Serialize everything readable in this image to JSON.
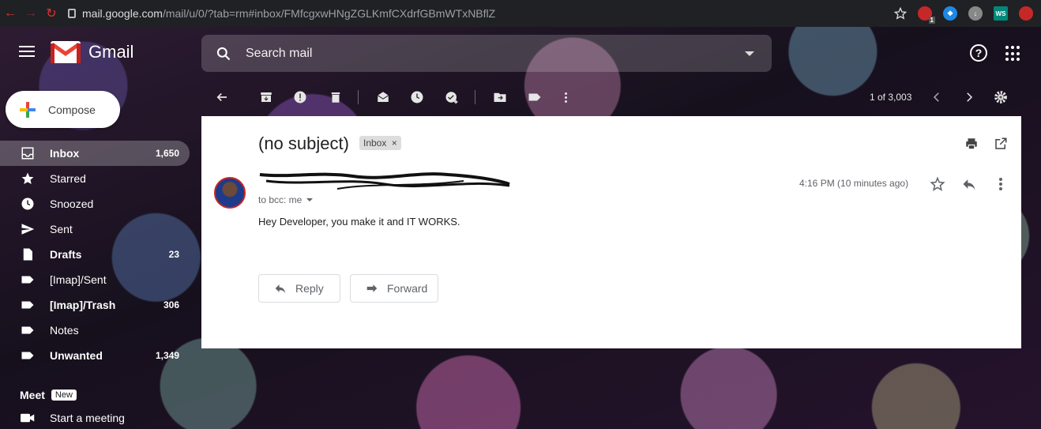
{
  "browser": {
    "url_host": "mail.google.com",
    "url_path": "/mail/u/0/?tab=rm#inbox/FMfcgxwHNgZGLKmfCXdrfGBmWTxNBflZ",
    "extension_badge": "1",
    "ext_ws_label": "WS"
  },
  "header": {
    "app_name": "Gmail",
    "search_placeholder": "Search mail",
    "help_label": "?"
  },
  "compose": {
    "label": "Compose"
  },
  "sidebar": {
    "items": [
      {
        "label": "Inbox",
        "count": "1,650",
        "icon": "inbox-icon",
        "active": true,
        "bold": true
      },
      {
        "label": "Starred",
        "count": "",
        "icon": "star-icon",
        "active": false,
        "bold": false
      },
      {
        "label": "Snoozed",
        "count": "",
        "icon": "clock-icon",
        "active": false,
        "bold": false
      },
      {
        "label": "Sent",
        "count": "",
        "icon": "send-icon",
        "active": false,
        "bold": false
      },
      {
        "label": "Drafts",
        "count": "23",
        "icon": "draft-icon",
        "active": false,
        "bold": true
      },
      {
        "label": "[Imap]/Sent",
        "count": "",
        "icon": "label-icon",
        "active": false,
        "bold": false
      },
      {
        "label": "[Imap]/Trash",
        "count": "306",
        "icon": "label-icon",
        "active": false,
        "bold": true
      },
      {
        "label": "Notes",
        "count": "",
        "icon": "label-icon",
        "active": false,
        "bold": false
      },
      {
        "label": "Unwanted",
        "count": "1,349",
        "icon": "label-icon",
        "active": false,
        "bold": true
      }
    ],
    "meet": {
      "title": "Meet",
      "badge": "New",
      "start_label": "Start a meeting"
    }
  },
  "toolbar": {
    "pager": "1 of 3,003"
  },
  "email": {
    "subject": "(no subject)",
    "label_chip": "Inbox",
    "recipient": "to bcc: me",
    "timestamp": "4:16 PM (10 minutes ago)",
    "body": "Hey Developer, you make it and IT WORKS.",
    "reply_label": "Reply",
    "forward_label": "Forward"
  },
  "colors": {
    "gmail_red": "#ea4335",
    "chrome_bar": "#202124",
    "card_bg": "#ffffff"
  }
}
